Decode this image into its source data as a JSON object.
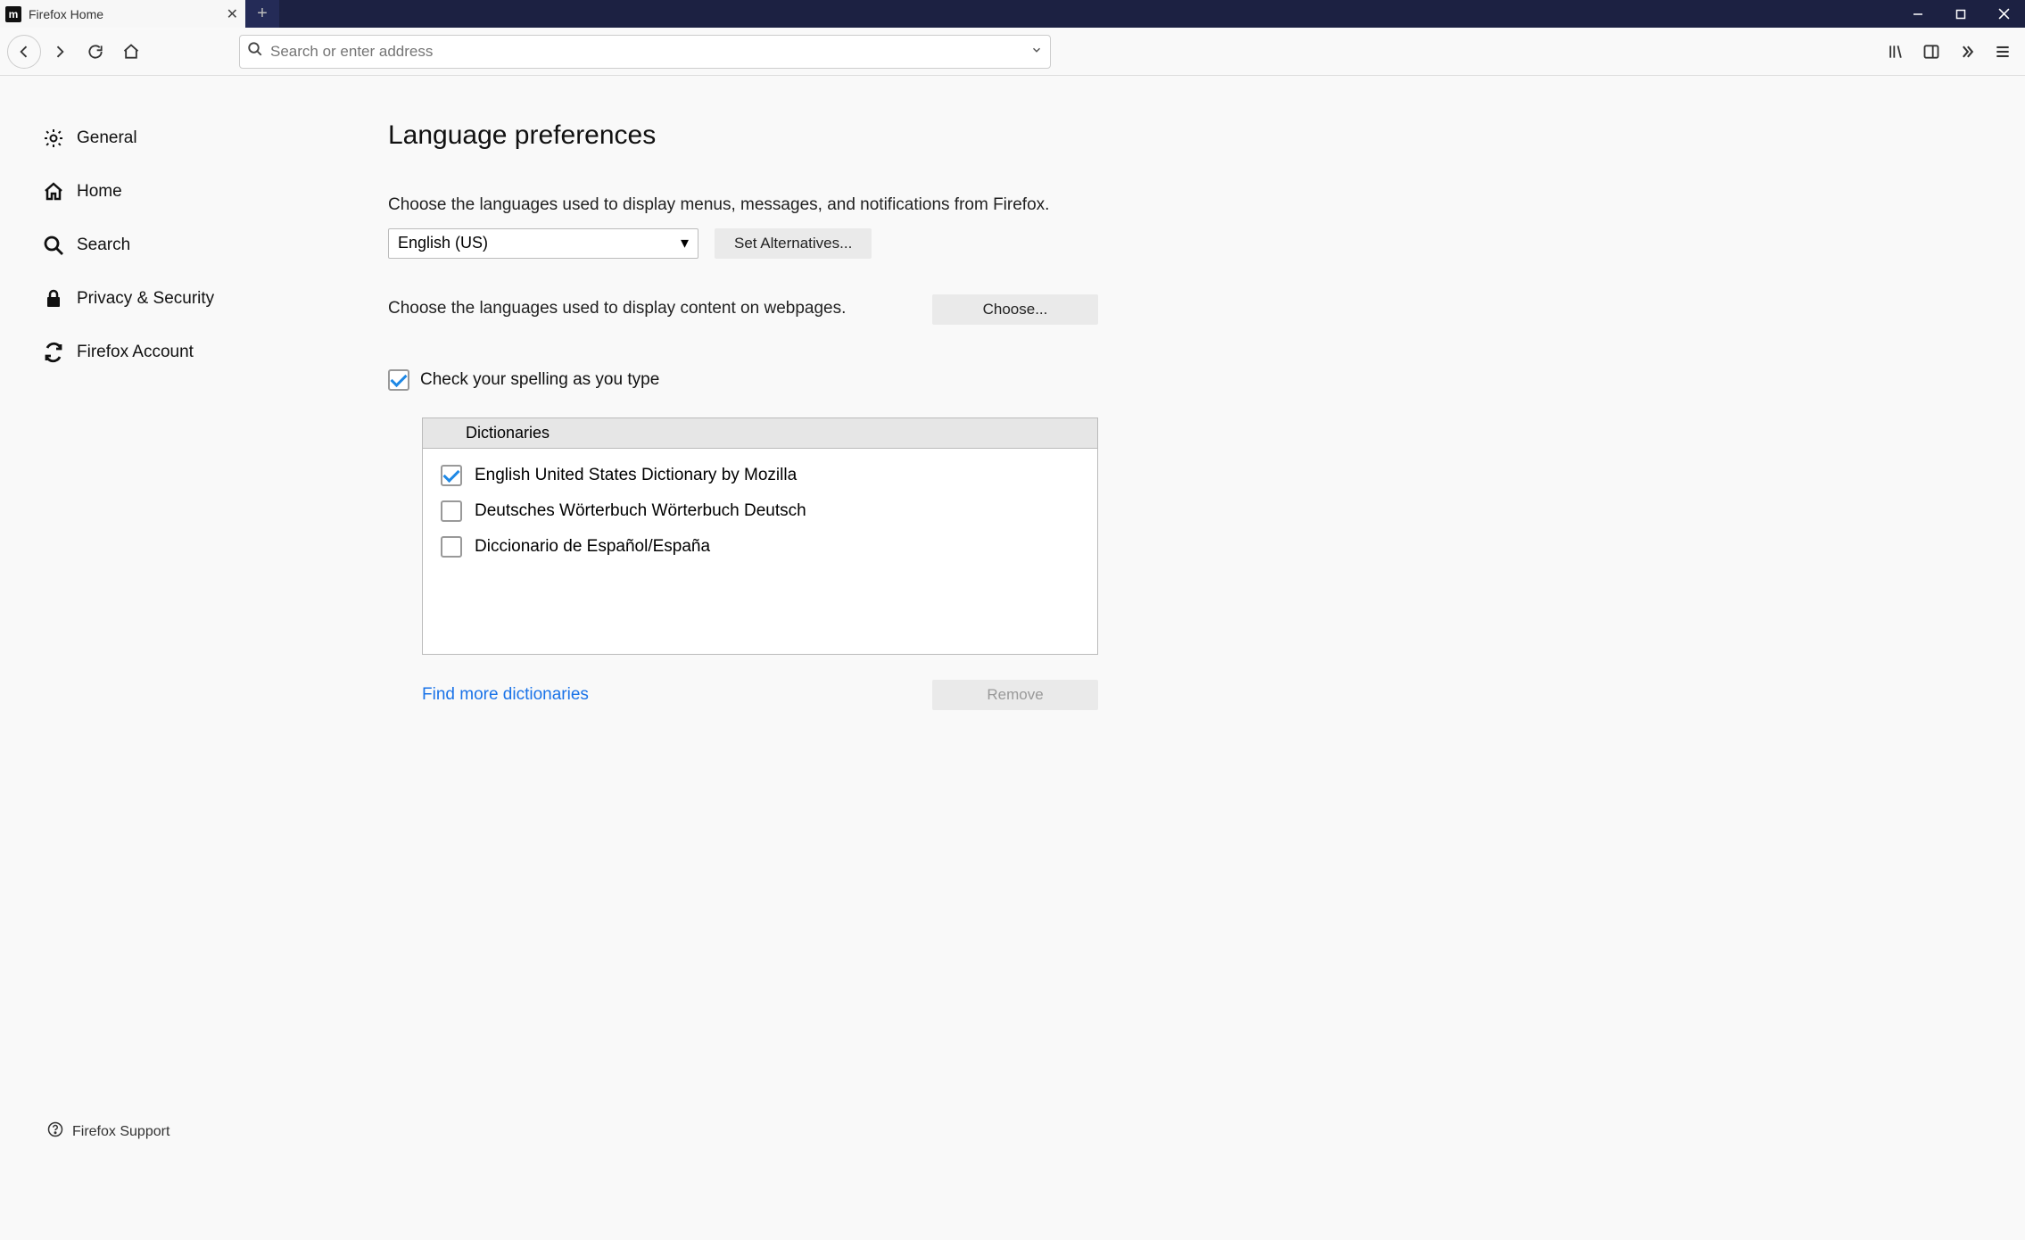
{
  "tab": {
    "title": "Firefox Home",
    "favicon_letter": "m"
  },
  "url_bar": {
    "placeholder": "Search or enter address"
  },
  "sidebar": {
    "items": [
      {
        "label": "General",
        "icon": "gear"
      },
      {
        "label": "Home",
        "icon": "home"
      },
      {
        "label": "Search",
        "icon": "search"
      },
      {
        "label": "Privacy & Security",
        "icon": "lock"
      },
      {
        "label": "Firefox Account",
        "icon": "sync"
      }
    ],
    "support_label": "Firefox Support"
  },
  "main": {
    "title": "Language preferences",
    "desc_menus": "Choose the languages used to display menus, messages, and notifications from Firefox.",
    "selected_language": "English (US)",
    "set_alt_button": "Set Alternatives...",
    "desc_content": "Choose the languages used to display content on webpages.",
    "choose_button": "Choose...",
    "spellcheck_label": "Check your spelling as you type",
    "spellcheck_checked": true,
    "dict_header": "Dictionaries",
    "dictionaries": [
      {
        "label": "English United States Dictionary by Mozilla",
        "checked": true
      },
      {
        "label": "Deutsches Wörterbuch Wörterbuch Deutsch",
        "checked": false
      },
      {
        "label": "Diccionario de Español/España",
        "checked": false
      }
    ],
    "find_more_link": "Find more dictionaries",
    "remove_button": "Remove"
  }
}
